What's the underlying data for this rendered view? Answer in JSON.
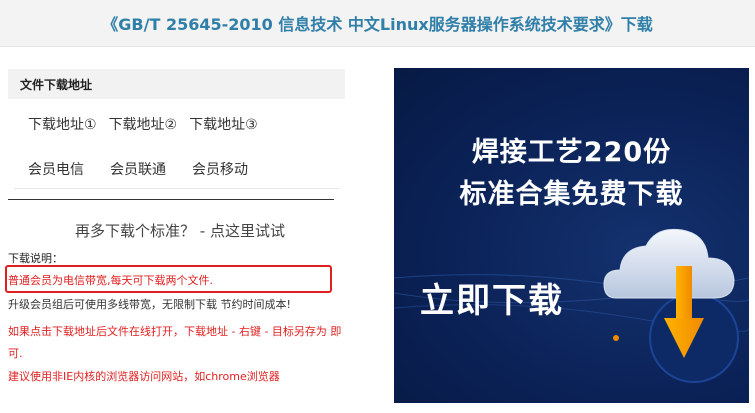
{
  "page_title": "《GB/T 25645-2010 信息技术 中文Linux服务器操作系统技术要求》下载",
  "panel": {
    "header": "文件下载地址"
  },
  "download_links": [
    "下载地址①",
    "下载地址②",
    "下载地址③"
  ],
  "member_links": [
    "会员电信",
    "会员联通",
    "会员移动"
  ],
  "more_text": "再多下载个标准？ - 点这里试试",
  "desc_label": "下载说明：",
  "notes": {
    "n1": "普通会员为电信带宽,每天可下载两个文件.",
    "n2": "升级会员组后可使用多线带宽，无限制下载 节约时间成本!",
    "n3": "如果点击下载地址后文件在线打开，下载地址 - 右键 - 目标另存为 即可.",
    "n4": "建议使用非IE内核的浏览器访问网站，如chrome浏览器"
  },
  "ad": {
    "line1": "焊接工艺220份",
    "line2": "标准合集免费下载",
    "cta": "立即下载",
    "icon": "cloud-download-icon",
    "colors": {
      "background": "#0b2257",
      "arrow": "#f5a400",
      "cloud": "#e8eef7"
    }
  },
  "colors": {
    "title": "#2f7fa8",
    "note_red": "#e02020",
    "highlight_box": "#e02020"
  }
}
